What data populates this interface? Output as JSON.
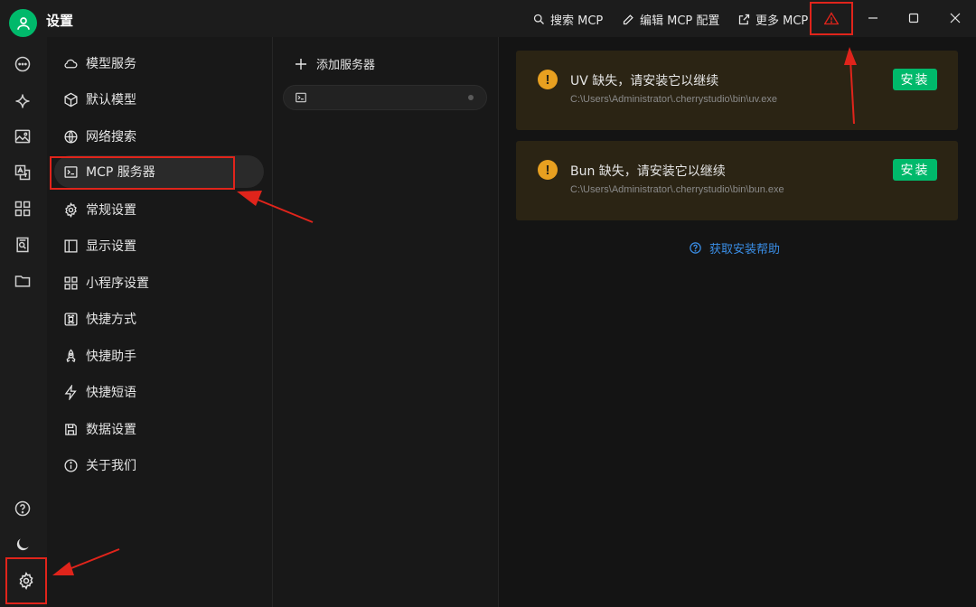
{
  "window": {
    "title": "设置"
  },
  "toolbar": {
    "search_label": "搜索 MCP",
    "edit_label": "编辑 MCP 配置",
    "more_label": "更多 MCP"
  },
  "menu": {
    "items": [
      {
        "label": "模型服务",
        "icon": "cloud-icon"
      },
      {
        "label": "默认模型",
        "icon": "cube-icon"
      },
      {
        "label": "网络搜索",
        "icon": "globe-icon"
      },
      {
        "label": "MCP 服务器",
        "icon": "terminal-icon",
        "active": true
      },
      {
        "label": "常规设置",
        "icon": "gear-icon"
      },
      {
        "label": "显示设置",
        "icon": "layout-icon"
      },
      {
        "label": "小程序设置",
        "icon": "grid-icon"
      },
      {
        "label": "快捷方式",
        "icon": "command-icon"
      },
      {
        "label": "快捷助手",
        "icon": "rocket-icon"
      },
      {
        "label": "快捷短语",
        "icon": "zap-icon"
      },
      {
        "label": "数据设置",
        "icon": "save-icon"
      },
      {
        "label": "关于我们",
        "icon": "info-icon"
      }
    ]
  },
  "servers": {
    "add_label": "添加服务器"
  },
  "warnings": [
    {
      "title": "UV 缺失，请安装它以继续",
      "path": "C:\\Users\\Administrator\\.cherrystudio\\bin\\uv.exe",
      "button": "安装"
    },
    {
      "title": "Bun 缺失，请安装它以继续",
      "path": "C:\\Users\\Administrator\\.cherrystudio\\bin\\bun.exe",
      "button": "安装"
    }
  ],
  "help_link": "获取安装帮助",
  "colors": {
    "accent": "#00b96b",
    "warning": "#e8a020",
    "link": "#3a8ee6",
    "annotation": "#e0241b"
  }
}
